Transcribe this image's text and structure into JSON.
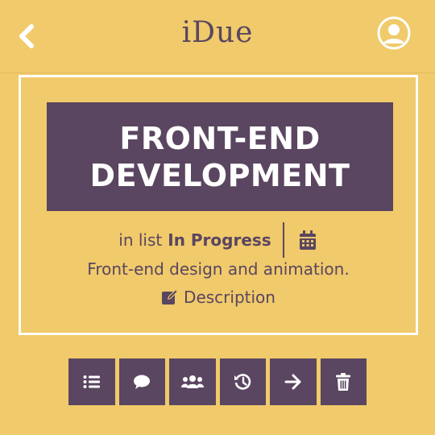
{
  "app": {
    "logo": "iDue"
  },
  "card": {
    "title": "FRONT-END DEVELOPMENT",
    "list_label": "in list",
    "list_name": "In Progress",
    "description": "Front-end design and animation.",
    "description_link": "Description"
  },
  "toolbar": {
    "buttons": [
      {
        "icon": "checklist-icon"
      },
      {
        "icon": "comment-icon"
      },
      {
        "icon": "members-icon"
      },
      {
        "icon": "history-icon"
      },
      {
        "icon": "move-arrow-icon"
      },
      {
        "icon": "trash-icon"
      }
    ]
  },
  "colors": {
    "background": "#F0CA6B",
    "accent": "#5A4660",
    "border": "#FFFFFF"
  }
}
